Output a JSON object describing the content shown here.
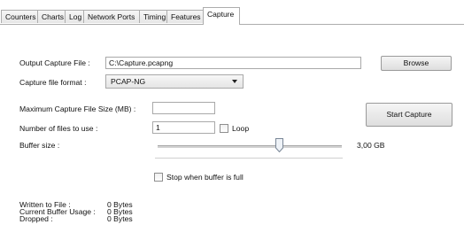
{
  "tabs": [
    {
      "label": "Counters"
    },
    {
      "label": "Charts"
    },
    {
      "label": "Log"
    },
    {
      "label": "Network Ports"
    },
    {
      "label": "Timing"
    },
    {
      "label": "Features"
    },
    {
      "label": "Capture",
      "active": true
    }
  ],
  "capture": {
    "output_file_label": "Output Capture File :",
    "output_file_value": "C:\\Capture.pcapng",
    "browse_label": "Browse",
    "format_label": "Capture file format :",
    "format_value": "PCAP-NG",
    "max_size_label": "Maximum Capture File Size (MB) :",
    "max_size_value": "",
    "start_capture_label": "Start Capture",
    "num_files_label": "Number of files to use :",
    "num_files_value": "1",
    "loop_label": "Loop",
    "loop_checked": false,
    "buffer_label": "Buffer size :",
    "buffer_value": "3,00 GB",
    "buffer_slider_fraction": 0.66,
    "stop_when_full_label": "Stop when buffer is full",
    "stop_when_full_checked": false
  },
  "status": {
    "written_label": "Written to File :",
    "written_value": "0 Bytes",
    "buffer_usage_label": "Current Buffer Usage :",
    "buffer_usage_value": "0 Bytes",
    "dropped_label": "Dropped :",
    "dropped_value": "0 Bytes"
  },
  "colors": {
    "tab_border": "#adadad",
    "control_border": "#a9a9a9"
  }
}
